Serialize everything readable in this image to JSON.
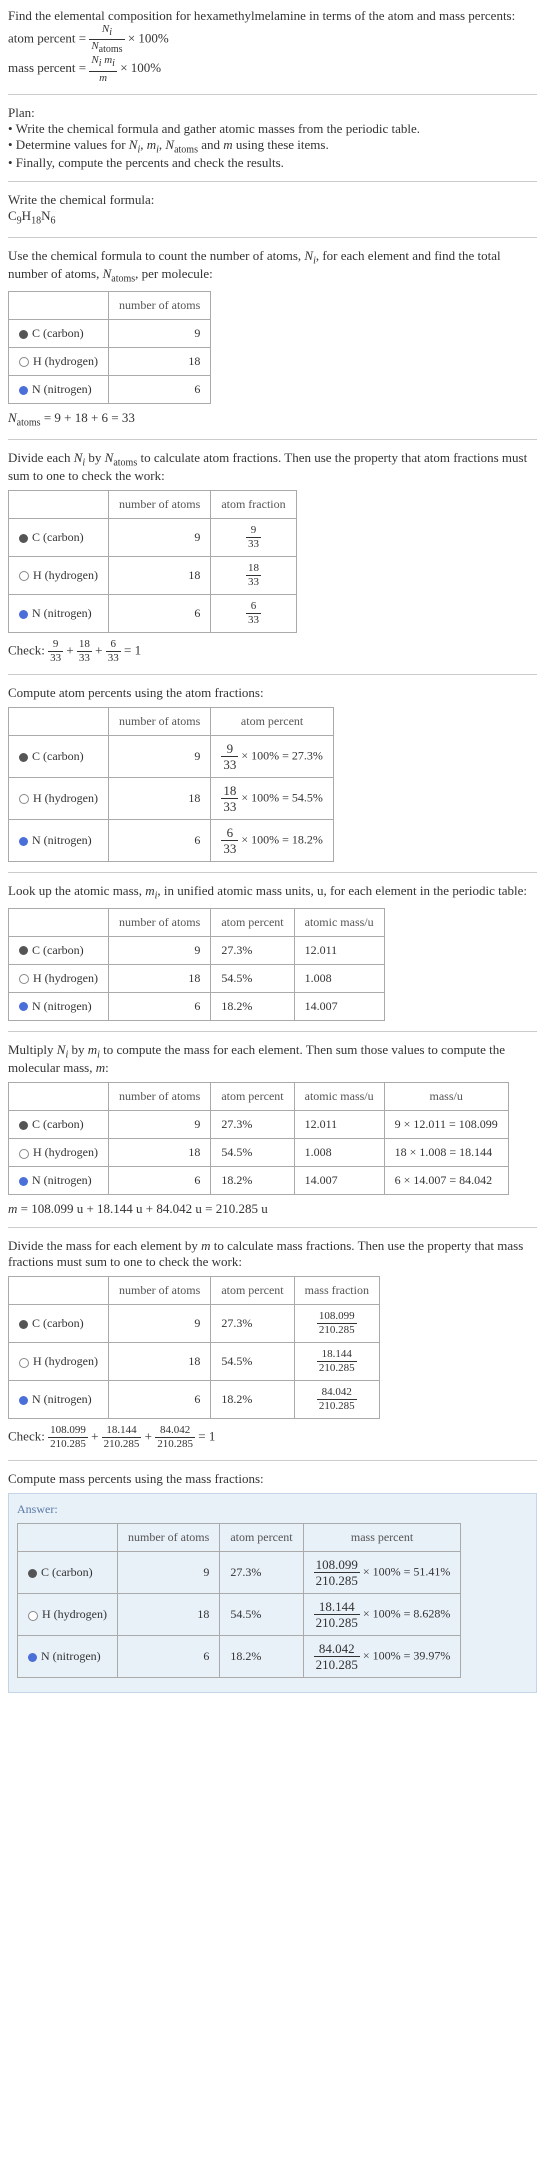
{
  "intro": {
    "line1": "Find the elemental composition for hexamethylmelamine in terms of the atom and mass percents:",
    "ap_lhs": "atom percent = ",
    "ap_num": "N_i",
    "ap_den": "N_atoms",
    "ap_rhs": " × 100%",
    "mp_lhs": "mass percent = ",
    "mp_num": "N_i m_i",
    "mp_den": "m",
    "mp_rhs": " × 100%"
  },
  "plan": {
    "title": "Plan:",
    "b1": "• Write the chemical formula and gather atomic masses from the periodic table.",
    "b2": "• Determine values for N_i, m_i, N_atoms and m using these items.",
    "b3": "• Finally, compute the percents and check the results."
  },
  "formula_section": {
    "title": "Write the chemical formula:",
    "formula_plain": "C9H18N6"
  },
  "count_section": {
    "text": "Use the chemical formula to count the number of atoms, N_i, for each element and find the total number of atoms, N_atoms, per molecule:",
    "h1": "number of atoms",
    "c_label": "C (carbon)",
    "c_n": "9",
    "h_label": "H (hydrogen)",
    "h_n": "18",
    "n_label": "N (nitrogen)",
    "n_n": "6",
    "sum": "N_atoms = 9 + 18 + 6 = 33"
  },
  "atomfrac_section": {
    "text": "Divide each N_i by N_atoms to calculate atom fractions. Then use the property that atom fractions must sum to one to check the work:",
    "h1": "number of atoms",
    "h2": "atom fraction",
    "c_n": "9",
    "c_f_num": "9",
    "c_f_den": "33",
    "h_n": "18",
    "h_f_num": "18",
    "h_f_den": "33",
    "n_n": "6",
    "n_f_num": "6",
    "n_f_den": "33",
    "check_label": "Check: ",
    "check_eq": " = 1"
  },
  "atompct_section": {
    "text": "Compute atom percents using the atom fractions:",
    "h1": "number of atoms",
    "h2": "atom percent",
    "c_n": "9",
    "c_num": "9",
    "c_den": "33",
    "c_res": " × 100% = 27.3%",
    "h_n": "18",
    "h_num": "18",
    "h_den": "33",
    "h_res": " × 100% = 54.5%",
    "n_n": "6",
    "n_num": "6",
    "n_den": "33",
    "n_res": " × 100% = 18.2%"
  },
  "mass_lookup": {
    "text": "Look up the atomic mass, m_i, in unified atomic mass units, u, for each element in the periodic table:",
    "h1": "number of atoms",
    "h2": "atom percent",
    "h3": "atomic mass/u",
    "c_n": "9",
    "c_p": "27.3%",
    "c_m": "12.011",
    "h_n": "18",
    "h_p": "54.5%",
    "h_m": "1.008",
    "n_n": "6",
    "n_p": "18.2%",
    "n_m": "14.007"
  },
  "molmass": {
    "text": "Multiply N_i by m_i to compute the mass for each element. Then sum those values to compute the molecular mass, m:",
    "h1": "number of atoms",
    "h2": "atom percent",
    "h3": "atomic mass/u",
    "h4": "mass/u",
    "c_n": "9",
    "c_p": "27.3%",
    "c_m": "12.011",
    "c_calc": "9 × 12.011 = 108.099",
    "h_n": "18",
    "h_p": "54.5%",
    "h_m": "1.008",
    "h_calc": "18 × 1.008 = 18.144",
    "n_n": "6",
    "n_p": "18.2%",
    "n_m": "14.007",
    "n_calc": "6 × 14.007 = 84.042",
    "sum": "m = 108.099 u + 18.144 u + 84.042 u = 210.285 u"
  },
  "massfrac": {
    "text": "Divide the mass for each element by m to calculate mass fractions. Then use the property that mass fractions must sum to one to check the work:",
    "h1": "number of atoms",
    "h2": "atom percent",
    "h3": "mass fraction",
    "c_n": "9",
    "c_p": "27.3%",
    "c_num": "108.099",
    "c_den": "210.285",
    "h_n": "18",
    "h_p": "54.5%",
    "h_num": "18.144",
    "h_den": "210.285",
    "n_n": "6",
    "n_p": "18.2%",
    "n_num": "84.042",
    "n_den": "210.285",
    "check_label": "Check: ",
    "check_eq": " = 1"
  },
  "masspct": {
    "text": "Compute mass percents using the mass fractions:"
  },
  "answer": {
    "label": "Answer:",
    "h1": "number of atoms",
    "h2": "atom percent",
    "h3": "mass percent",
    "c_n": "9",
    "c_p": "27.3%",
    "c_num": "108.099",
    "c_den": "210.285",
    "c_res": " × 100% = 51.41%",
    "h_n": "18",
    "h_p": "54.5%",
    "h_num": "18.144",
    "h_den": "210.285",
    "h_res": " × 100% = 8.628%",
    "n_n": "6",
    "n_p": "18.2%",
    "n_num": "84.042",
    "n_den": "210.285",
    "n_res": " × 100% = 39.97%"
  },
  "labels": {
    "c": "C (carbon)",
    "h": "H (hydrogen)",
    "n": "N (nitrogen)"
  }
}
